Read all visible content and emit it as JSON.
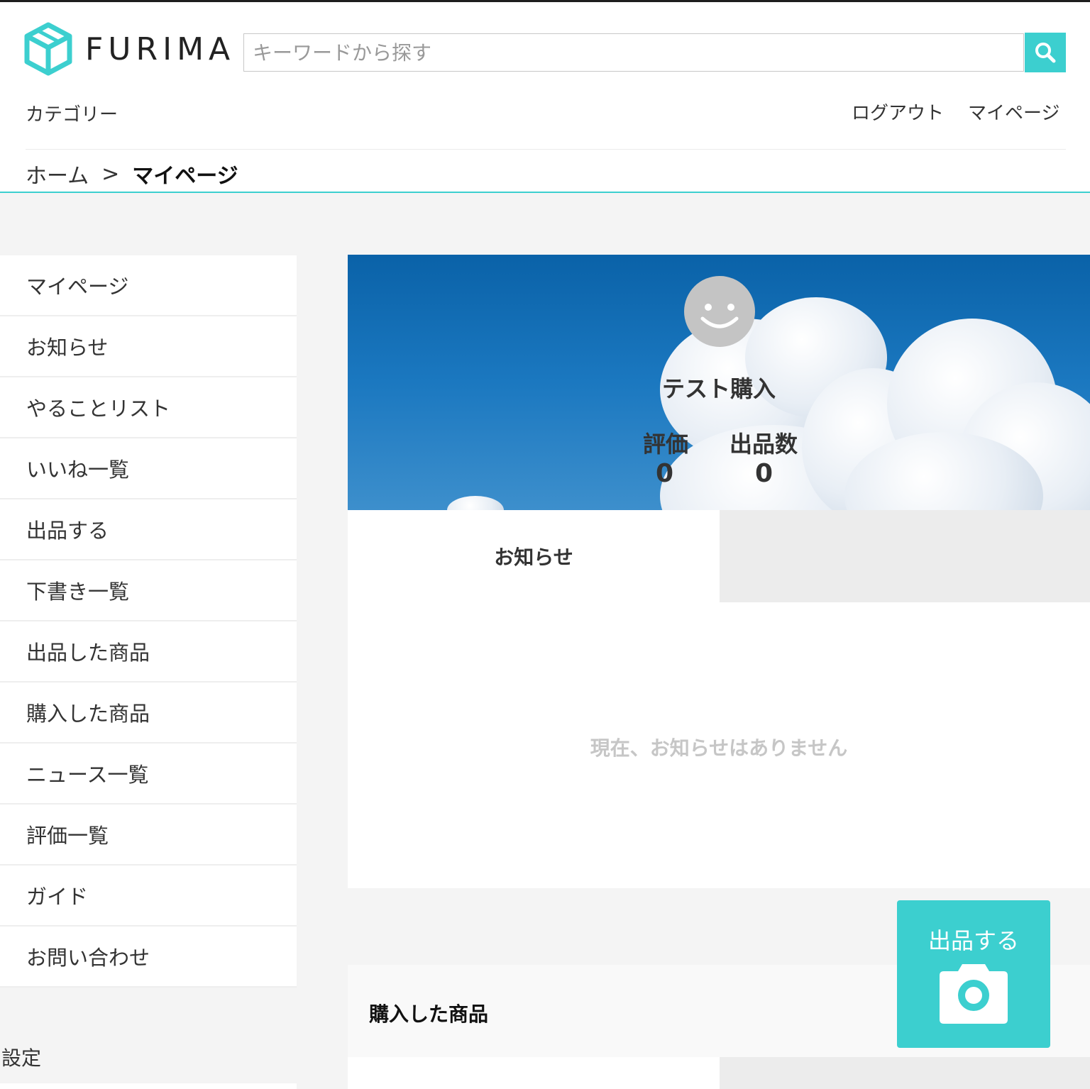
{
  "brand": {
    "name": "FURIMA",
    "accent": "#3ccfcf"
  },
  "search": {
    "placeholder": "キーワードから探す",
    "icon": "search-icon"
  },
  "nav": {
    "category": "カテゴリー",
    "logout": "ログアウト",
    "mypage": "マイページ"
  },
  "breadcrumb": {
    "home": "ホーム",
    "separator": ">",
    "current": "マイページ"
  },
  "sidebar": {
    "items": [
      {
        "label": "マイページ"
      },
      {
        "label": "お知らせ"
      },
      {
        "label": "やることリスト"
      },
      {
        "label": "いいね一覧"
      },
      {
        "label": "出品する"
      },
      {
        "label": "下書き一覧"
      },
      {
        "label": "出品した商品"
      },
      {
        "label": "購入した商品"
      },
      {
        "label": "ニュース一覧"
      },
      {
        "label": "評価一覧"
      },
      {
        "label": "ガイド"
      },
      {
        "label": "お問い合わせ"
      }
    ],
    "settings": "設定"
  },
  "profile": {
    "user_name": "テスト購入",
    "rating_label": "評価",
    "rating_value": "0",
    "listings_label": "出品数",
    "listings_value": "0"
  },
  "notice_tabs": {
    "active_label": "お知らせ",
    "empty_message": "現在、お知らせはありません"
  },
  "purchased": {
    "title": "購入した商品"
  },
  "sell_button": {
    "label": "出品する",
    "icon": "camera-icon"
  }
}
